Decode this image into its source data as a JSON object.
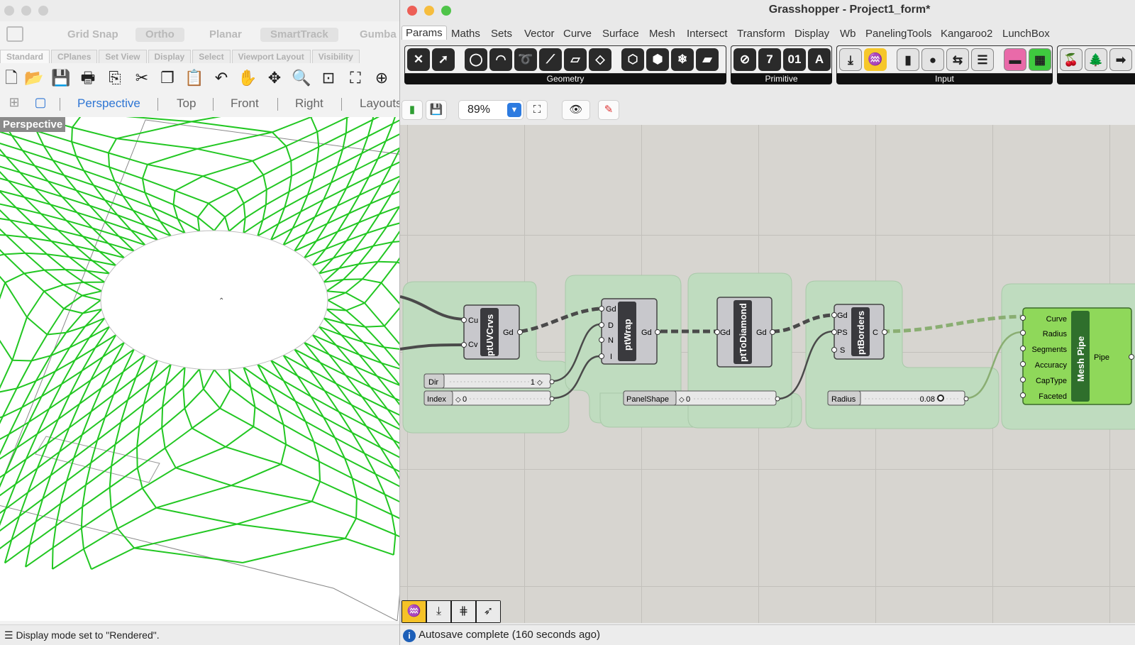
{
  "rhino": {
    "osnap_items": [
      {
        "label": "Grid Snap",
        "on": false
      },
      {
        "label": "Ortho",
        "on": true
      },
      {
        "label": "Planar",
        "on": false
      },
      {
        "label": "SmartTrack",
        "on": true
      },
      {
        "label": "Gumba",
        "on": false
      }
    ],
    "toolbar_tabs": [
      "Standard",
      "CPlanes",
      "Set View",
      "Display",
      "Select",
      "Viewport Layout",
      "Visibility"
    ],
    "tools": [
      "new-file-icon",
      "open-folder-icon",
      "save-icon",
      "print-icon",
      "import-icon",
      "cut-icon",
      "copy-icon",
      "paste-icon",
      "undo-icon",
      "pan-hand-icon",
      "rotate-view-icon",
      "zoom-icon",
      "zoom-window-icon",
      "zoom-extents-icon",
      "zoom-selected-icon"
    ],
    "viewport_tabs": [
      "Perspective",
      "Top",
      "Front",
      "Right",
      "Layouts"
    ],
    "active_viewport_tab": "Perspective",
    "viewport_label": "Perspective",
    "status": "Display mode set to \"Rendered\".",
    "mesh_color": "#22c722"
  },
  "grasshopper": {
    "title": "Grasshopper - Project1_form*",
    "menus": [
      "Params",
      "Maths",
      "Sets",
      "Vector",
      "Curve",
      "Surface",
      "Mesh",
      "Intersect",
      "Transform",
      "Display",
      "Wb",
      "PanelingTools",
      "Kangaroo2",
      "LunchBox"
    ],
    "active_menu": "Params",
    "ribbon_groups": [
      {
        "label": "Geometry"
      },
      {
        "label": "Primitive"
      },
      {
        "label": "Input"
      }
    ],
    "zoom": "89%",
    "status": "Autosave complete (160 seconds ago)",
    "components": {
      "pt_uv_crvs": {
        "name": "ptUVCrvs",
        "inputs": [
          "Cu",
          "Cv"
        ],
        "outputs": [
          "Gd"
        ]
      },
      "pt_wrap": {
        "name": "ptWrap",
        "inputs": [
          "Gd",
          "D",
          "N",
          "I"
        ],
        "outputs": [
          "Gd"
        ]
      },
      "pt_to_diamond": {
        "name": "ptToDiamond",
        "inputs": [
          "Gd"
        ],
        "outputs": [
          "Gd"
        ]
      },
      "pt_borders": {
        "name": "ptBorders",
        "inputs": [
          "Gd",
          "PS",
          "S"
        ],
        "outputs": [
          "C"
        ]
      },
      "mesh_pipe": {
        "name": "Mesh Pipe",
        "inputs": [
          "Curve",
          "Radius",
          "Segments",
          "Accuracy",
          "CapType",
          "Faceted"
        ],
        "outputs": [
          "Pipe"
        ]
      }
    },
    "sliders": {
      "dir": {
        "label": "Dir",
        "value": "1"
      },
      "index": {
        "label": "Index",
        "value": "0"
      },
      "panel_shape": {
        "label": "PanelShape",
        "value": "0"
      },
      "radius": {
        "label": "Radius",
        "value": "0.08"
      }
    },
    "group_color": "#bfdcbf",
    "mesh_pipe_color": "#8fd85a"
  }
}
